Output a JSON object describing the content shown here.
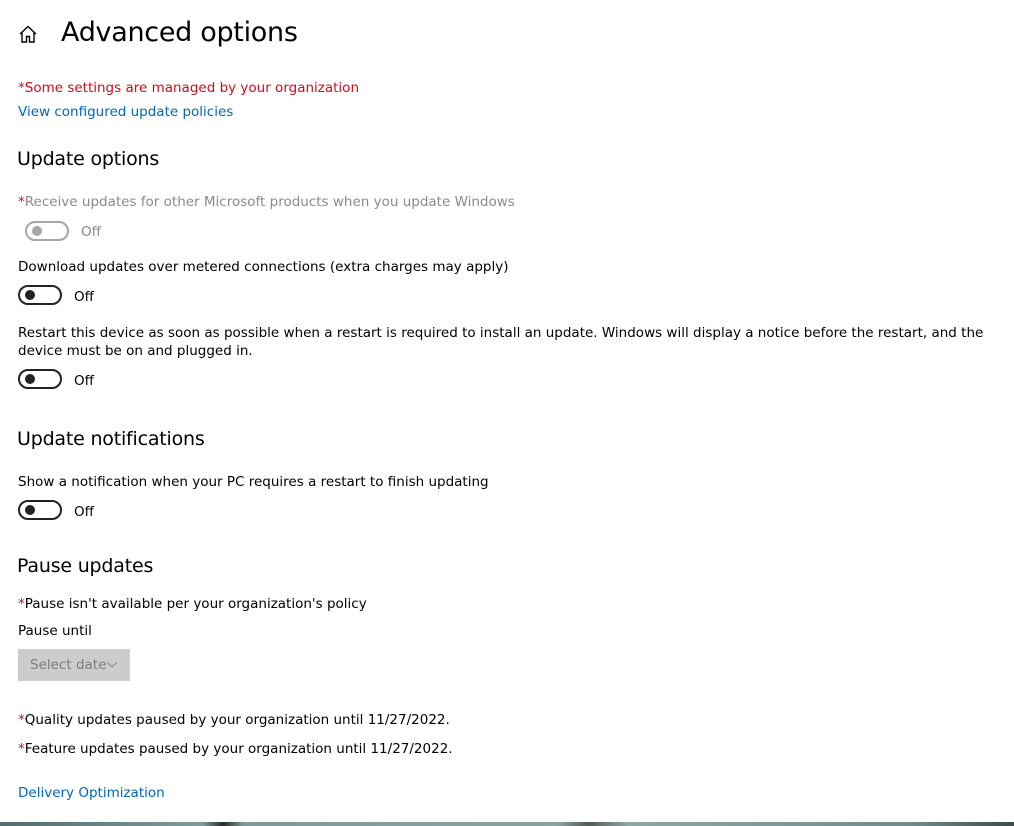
{
  "header": {
    "title": "Advanced options",
    "home_icon": "home-icon"
  },
  "org_notice": "*Some settings are managed by your organization",
  "view_policies_link": "View configured update policies",
  "update_options": {
    "title": "Update options",
    "receive_updates": {
      "asterisk": "*",
      "label": "Receive updates for other Microsoft products when you update Windows",
      "state": "Off",
      "enabled": false
    },
    "metered": {
      "label": "Download updates over metered connections (extra charges may apply)",
      "state": "Off"
    },
    "restart_asap": {
      "label": "Restart this device as soon as possible when a restart is required to install an update. Windows will display a notice before the restart, and the device must be on and plugged in.",
      "state": "Off"
    }
  },
  "update_notifications": {
    "title": "Update notifications",
    "show_notification": {
      "label": "Show a notification when your PC requires a restart to finish updating",
      "state": "Off"
    }
  },
  "pause_updates": {
    "title": "Pause updates",
    "policy_notice_asterisk": "*",
    "policy_notice": "Pause isn't available per your organization's policy",
    "pause_until_label": "Pause until",
    "select_date": "Select date",
    "quality_asterisk": "*",
    "quality_notice": "Quality updates paused by your organization until 11/27/2022.",
    "feature_asterisk": "*",
    "feature_notice": "Feature updates paused by your organization until 11/27/2022."
  },
  "delivery_optimization_link": "Delivery Optimization",
  "colors": {
    "accent_link": "#0067b8",
    "managed_red": "#c50f1f",
    "disabled_gray": "#8a8a8a"
  }
}
